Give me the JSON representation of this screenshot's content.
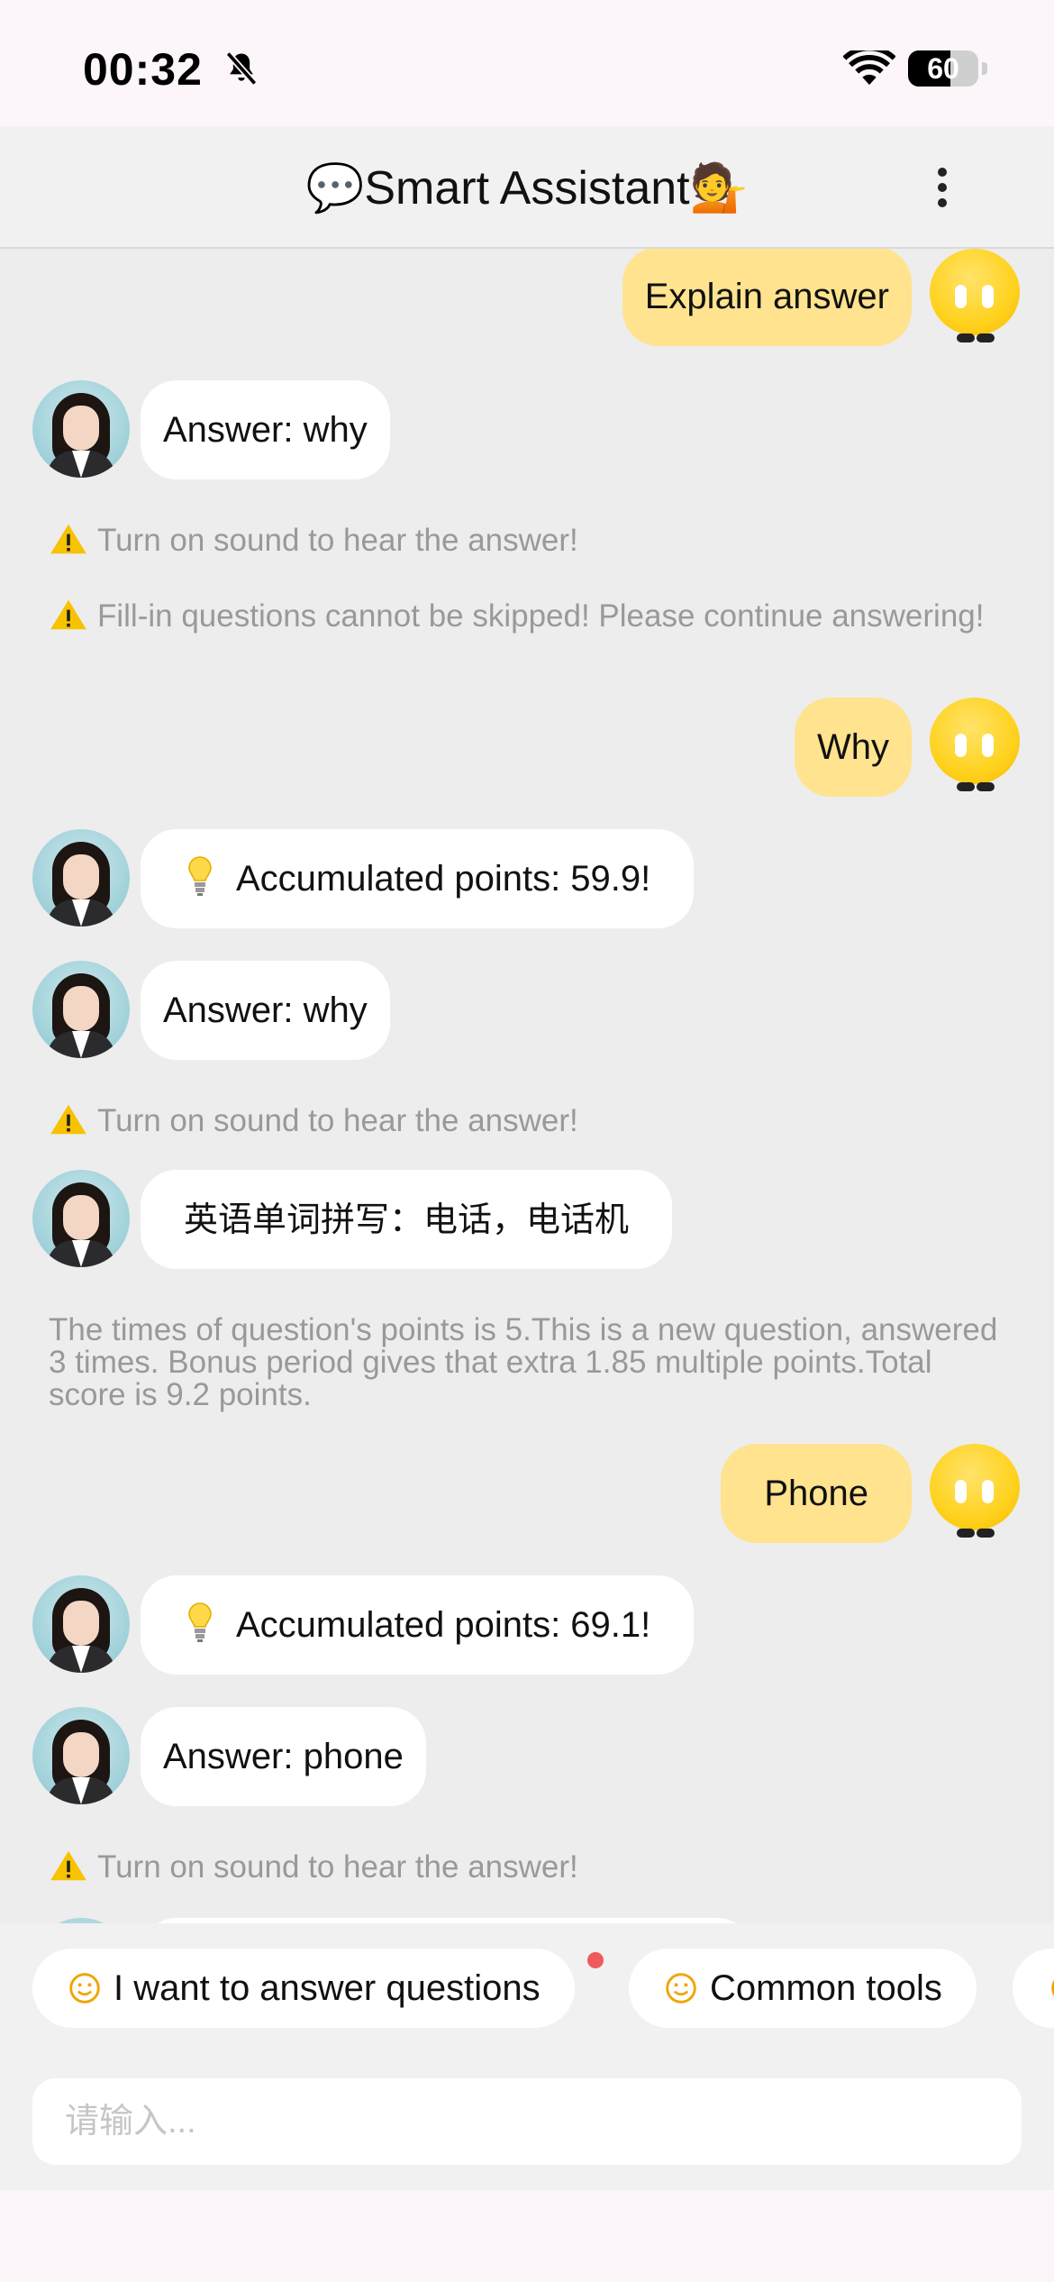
{
  "status_bar": {
    "time": "00:32",
    "battery": "60",
    "battery_level": 0.6
  },
  "header": {
    "title": "Smart Assistant",
    "left_emoji": "💬",
    "right_emoji": "💁"
  },
  "messages": [
    {
      "text": "Explain answer"
    },
    {
      "text": "Answer: why"
    },
    {
      "text": "Turn on sound to hear the answer!"
    },
    {
      "text": "Fill-in questions cannot be skipped! Please continue answering!"
    },
    {
      "text": "Why"
    },
    {
      "text": "Accumulated points: 59.9!"
    },
    {
      "text": "Answer: why"
    },
    {
      "text": "Turn on sound to hear the answer!"
    },
    {
      "text": "英语单词拼写：电话，电话机"
    },
    {
      "text": "The times of question's points is 5.This is a new question, answered 3 times. Bonus period gives that extra 1.85 multiple points.Total score is 9.2 points."
    },
    {
      "text": "Phone"
    },
    {
      "text": "Accumulated points: 69.1!"
    },
    {
      "text": "Answer: phone"
    },
    {
      "text": "Turn on sound to hear the answer!"
    }
  ],
  "quick_actions": [
    {
      "label": "I want to answer questions"
    },
    {
      "label": "Common tools"
    }
  ],
  "composer": {
    "placeholder": "请输入..."
  },
  "colors": {
    "user_bubble": "#ffe38e",
    "assistant_bubble": "#ffffff",
    "chat_bg": "#ededed",
    "notice_text": "#999999",
    "badge": "#f05a5a"
  }
}
